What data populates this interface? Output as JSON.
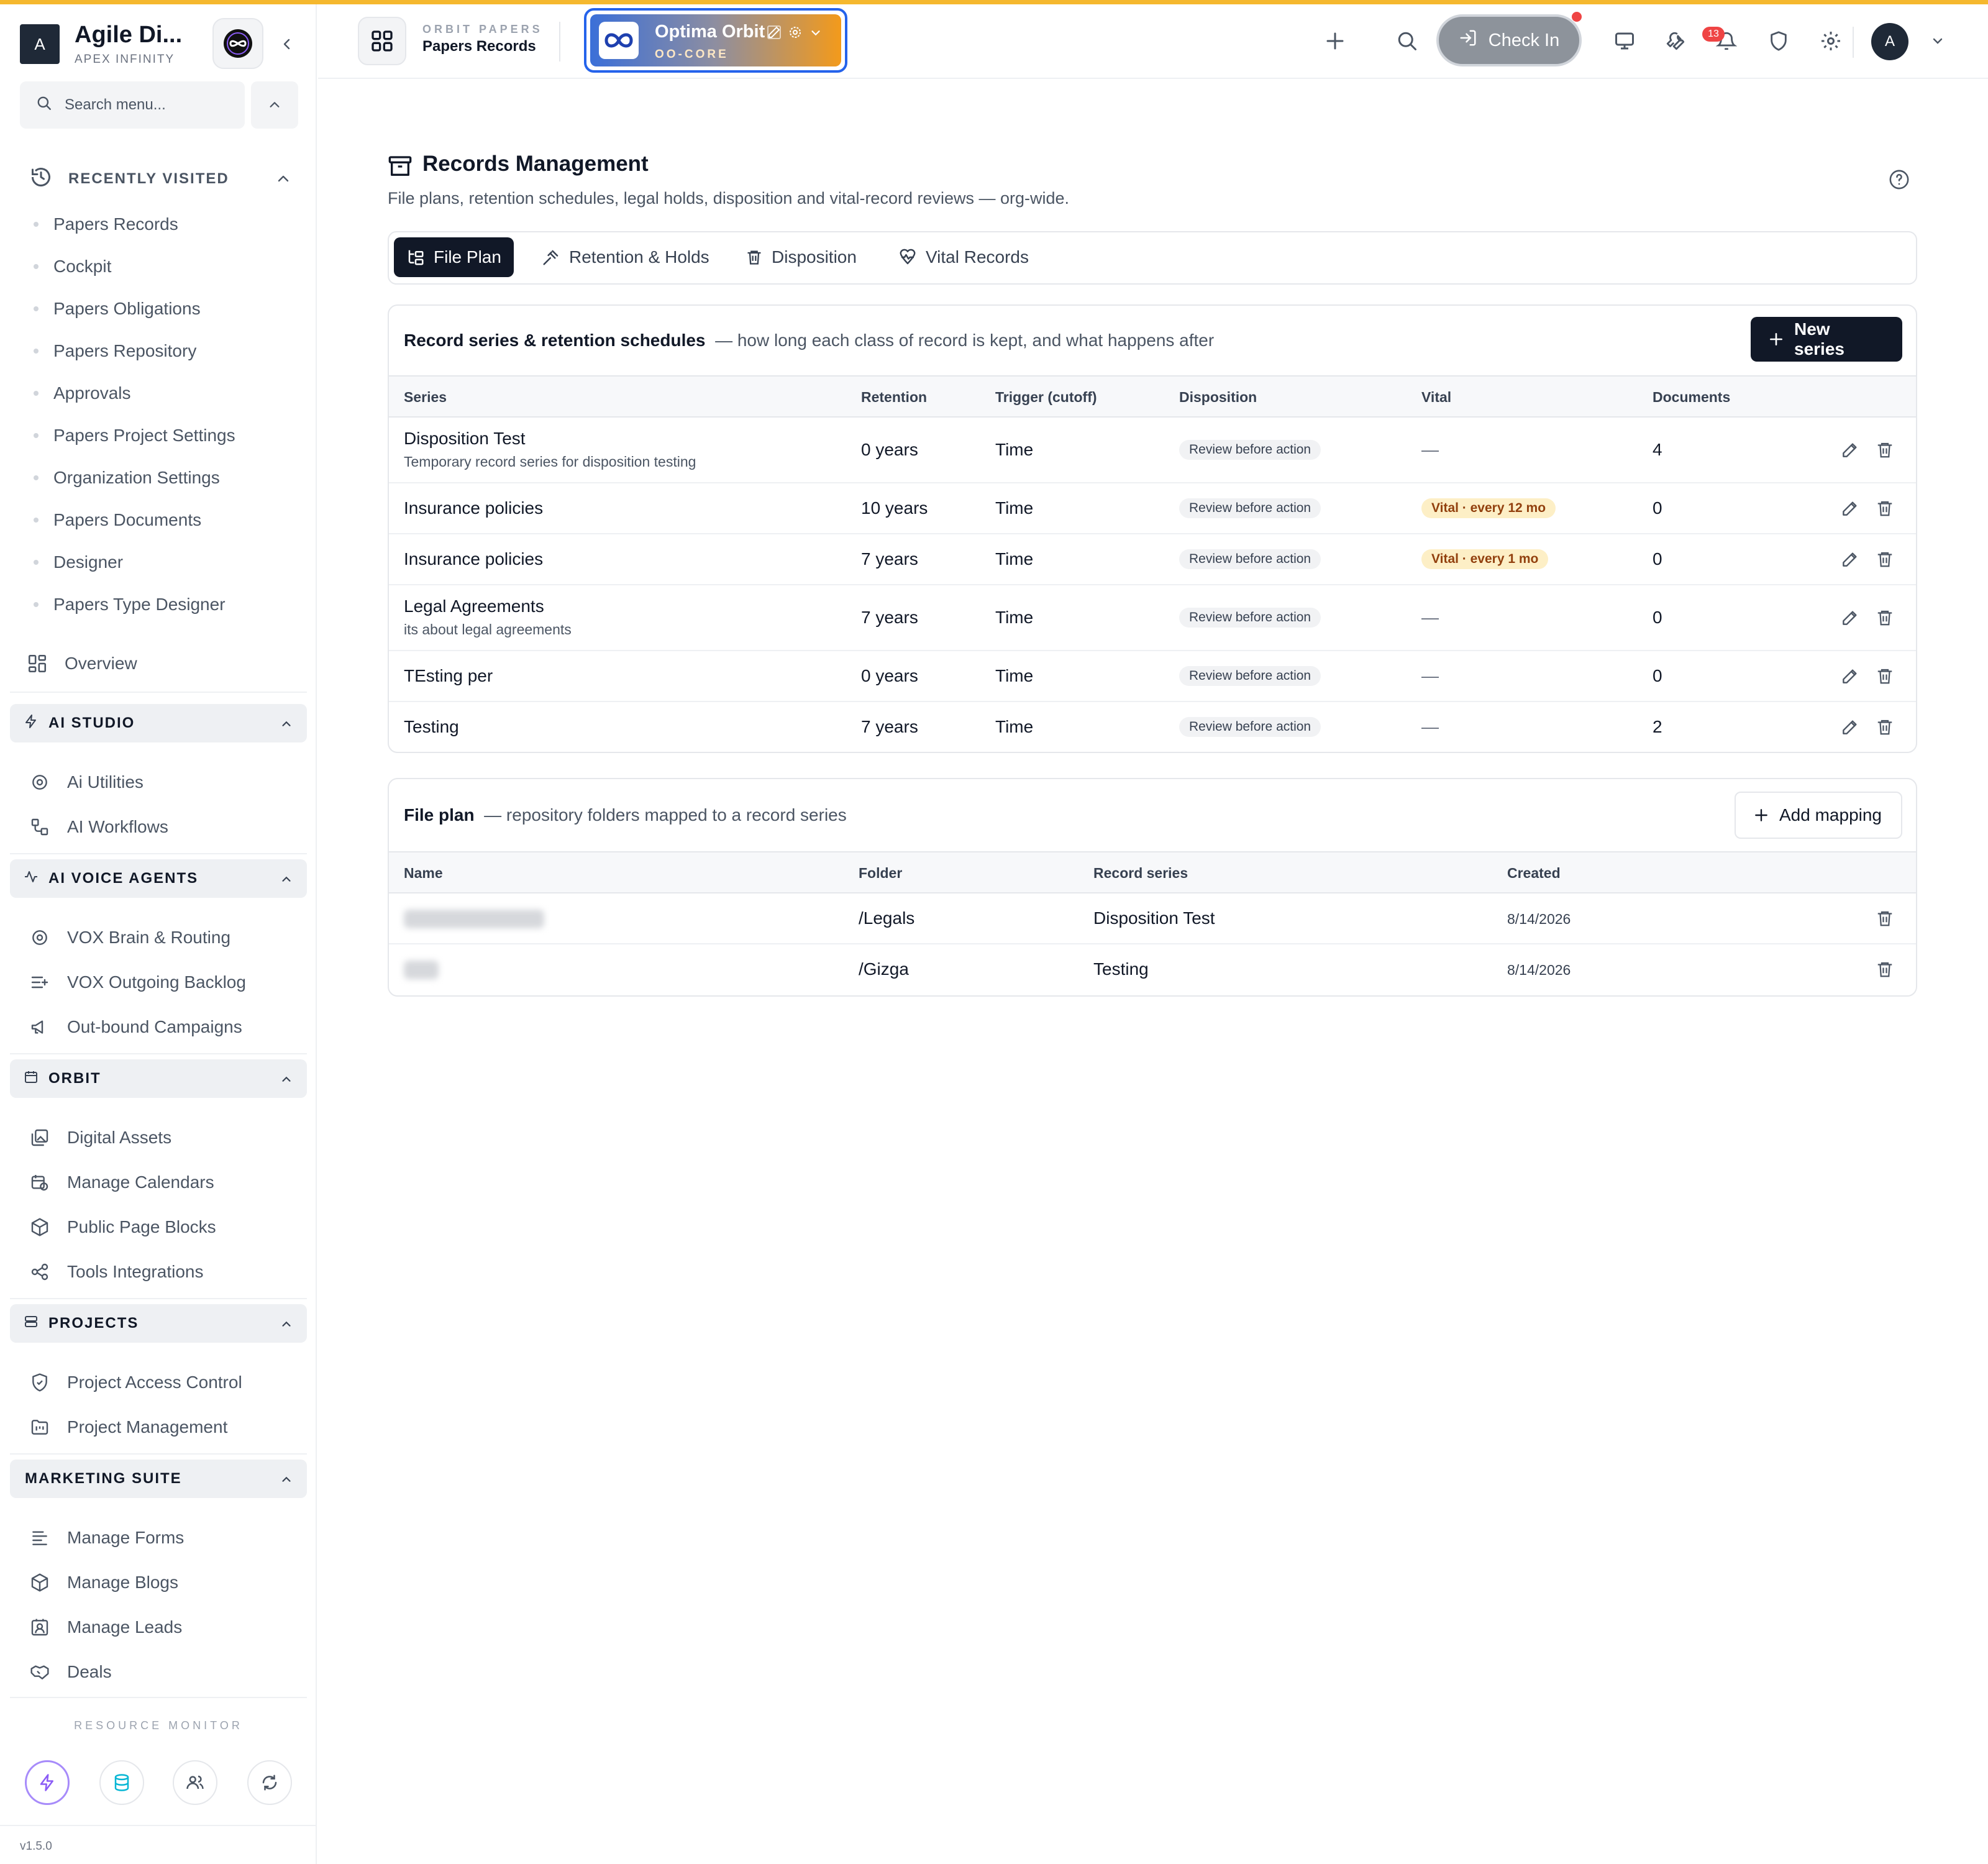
{
  "brand": {
    "initial": "A",
    "name": "Agile Di...",
    "subtitle": "APEX INFINITY"
  },
  "sidebar": {
    "search_placeholder": "Search menu...",
    "recent_title": "RECENTLY VISITED",
    "recent": [
      "Papers Records",
      "Cockpit",
      "Papers Obligations",
      "Papers Repository",
      "Approvals",
      "Papers Project Settings",
      "Organization Settings",
      "Papers Documents",
      "Designer",
      "Papers Type Designer"
    ],
    "overview": "Overview",
    "sections": [
      {
        "title": "AI STUDIO",
        "items": [
          "Ai Utilities",
          "AI Workflows"
        ]
      },
      {
        "title": "AI VOICE AGENTS",
        "items": [
          "VOX Brain & Routing",
          "VOX Outgoing Backlog",
          "Out-bound Campaigns"
        ]
      },
      {
        "title": "ORBIT",
        "items": [
          "Digital Assets",
          "Manage Calendars",
          "Public Page Blocks",
          "Tools Integrations"
        ]
      },
      {
        "title": "PROJECTS",
        "items": [
          "Project Access Control",
          "Project Management"
        ]
      },
      {
        "title": "MARKETING SUITE",
        "items": [
          "Manage Forms",
          "Manage Blogs",
          "Manage Leads",
          "Deals"
        ]
      }
    ],
    "resource_monitor": "RESOURCE MONITOR",
    "version": "v1.5.0"
  },
  "header": {
    "crumb_sub": "ORBIT PAPERS",
    "crumb": "Papers Records",
    "org_name": "Optima Orbit",
    "org_code": "OO-CORE",
    "checkin": "Check In",
    "notifications_count": "13",
    "avatar": "A"
  },
  "page": {
    "title": "Records Management",
    "description": "File plans, retention schedules, legal holds, disposition and vital-record reviews — org-wide."
  },
  "tabs": [
    "File Plan",
    "Retention & Holds",
    "Disposition",
    "Vital Records"
  ],
  "series_card": {
    "title": "Record series & retention schedules",
    "subtitle": "— how long each class of record is kept, and what happens after",
    "new_button": "New series",
    "columns": [
      "Series",
      "Retention",
      "Trigger (cutoff)",
      "Disposition",
      "Vital",
      "Documents"
    ],
    "rows": [
      {
        "name": "Disposition Test",
        "desc": "Temporary record series for disposition testing",
        "retention": "0 years",
        "trigger": "Time",
        "disposition": "Review before action",
        "vital": "—",
        "documents": "4"
      },
      {
        "name": "Insurance policies",
        "desc": "",
        "retention": "10 years",
        "trigger": "Time",
        "disposition": "Review before action",
        "vital": "Vital · every 12 mo",
        "documents": "0"
      },
      {
        "name": "Insurance policies",
        "desc": "",
        "retention": "7 years",
        "trigger": "Time",
        "disposition": "Review before action",
        "vital": "Vital · every 1 mo",
        "documents": "0"
      },
      {
        "name": "Legal Agreements",
        "desc": "its about legal agreements",
        "retention": "7 years",
        "trigger": "Time",
        "disposition": "Review before action",
        "vital": "—",
        "documents": "0"
      },
      {
        "name": "TEsting per",
        "desc": "",
        "retention": "0 years",
        "trigger": "Time",
        "disposition": "Review before action",
        "vital": "—",
        "documents": "0"
      },
      {
        "name": "Testing",
        "desc": "",
        "retention": "7 years",
        "trigger": "Time",
        "disposition": "Review before action",
        "vital": "—",
        "documents": "2"
      }
    ]
  },
  "fileplan_card": {
    "title": "File plan",
    "subtitle": "— repository folders mapped to a record series",
    "add_button": "Add mapping",
    "columns": [
      "Name",
      "Folder",
      "Record series",
      "Created"
    ],
    "rows": [
      {
        "folder": "/Legals",
        "series": "Disposition Test",
        "created": "8/14/2026"
      },
      {
        "folder": "/Gizga",
        "series": "Testing",
        "created": "8/14/2026"
      }
    ]
  }
}
